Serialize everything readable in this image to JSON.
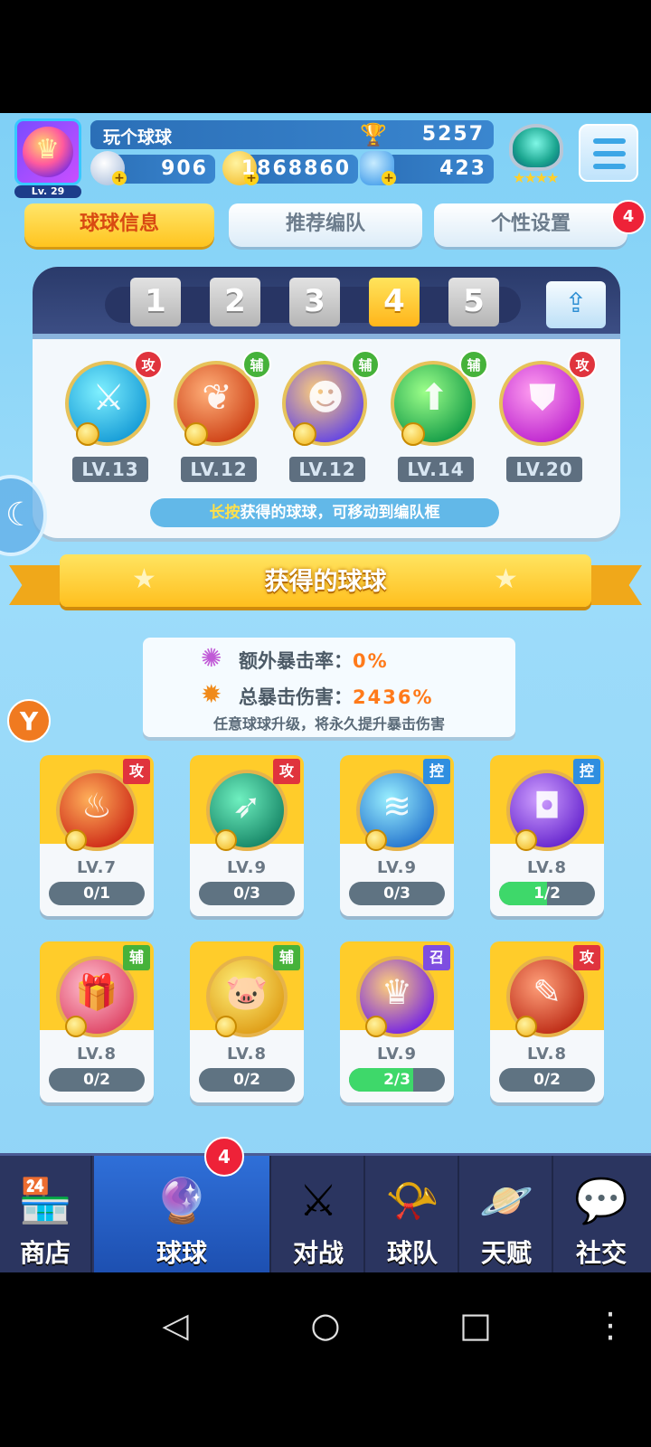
{
  "player": {
    "name": "玩个球球",
    "level_label": "Lv. 29",
    "trophies": "5257",
    "currency": [
      {
        "name": "silver",
        "value": "906",
        "color": "#c4d6ee"
      },
      {
        "name": "gold",
        "value": "1868860",
        "color": "#ffd21a"
      },
      {
        "name": "diamond",
        "value": "423",
        "color": "#4ab0ff"
      }
    ]
  },
  "tabs": [
    {
      "label": "球球信息",
      "active": true
    },
    {
      "label": "推荐编队",
      "active": false
    },
    {
      "label": "个性设置",
      "active": false,
      "badge": "4"
    }
  ],
  "team": {
    "slots": [
      "1",
      "2",
      "3",
      "4",
      "5"
    ],
    "selected_slot": "4",
    "balls": [
      {
        "tag": "攻",
        "tag_type": "atk",
        "level": "LV.13",
        "colors": [
          "#7ff0ff",
          "#1a9fd8"
        ],
        "icon": "blades-icon",
        "glyph": "⚔"
      },
      {
        "tag": "辅",
        "tag_type": "sup",
        "level": "LV.12",
        "colors": [
          "#ffb07a",
          "#d0461a"
        ],
        "icon": "wings-icon",
        "glyph": "❦"
      },
      {
        "tag": "辅",
        "tag_type": "sup",
        "level": "LV.12",
        "colors": [
          "#ffd07a",
          "#6a4ae0"
        ],
        "icon": "people-icon",
        "glyph": "☻"
      },
      {
        "tag": "辅",
        "tag_type": "sup",
        "level": "LV.14",
        "colors": [
          "#9dff8a",
          "#1aa04a"
        ],
        "icon": "arrow-up-icon",
        "glyph": "⬆"
      },
      {
        "tag": "攻",
        "tag_type": "atk",
        "level": "LV.20",
        "colors": [
          "#ff9ef0",
          "#c02ad0"
        ],
        "icon": "shield-icon",
        "glyph": "⛊"
      }
    ],
    "hint_highlight": "长按",
    "hint_text": "获得的球球，可移动到编队框"
  },
  "collection": {
    "title": "获得的球球",
    "extra_crit_label": "额外暴击率：",
    "extra_crit_value": "0%",
    "total_crit_label": "总暴击伤害：",
    "total_crit_value": "2436%",
    "note": "任意球球升级，将永久提升暴击伤害"
  },
  "cards": [
    {
      "tag": "攻",
      "tag_type": "atk",
      "level": "LV.7",
      "progress": "0/1",
      "fraction": 0.0,
      "colors": [
        "#ffb05a",
        "#d0301a"
      ],
      "icon": "dragon-icon",
      "glyph": "♨"
    },
    {
      "tag": "攻",
      "tag_type": "atk",
      "level": "LV.9",
      "progress": "0/3",
      "fraction": 0.0,
      "colors": [
        "#6ff0c0",
        "#1a8a6a"
      ],
      "icon": "bow-icon",
      "glyph": "➶"
    },
    {
      "tag": "控",
      "tag_type": "ctl",
      "level": "LV.9",
      "progress": "0/3",
      "fraction": 0.0,
      "colors": [
        "#9af0ff",
        "#2a7ad0"
      ],
      "icon": "wind-icon",
      "glyph": "≋"
    },
    {
      "tag": "控",
      "tag_type": "ctl",
      "level": "LV.8",
      "progress": "1/2",
      "fraction": 0.5,
      "colors": [
        "#d0a0ff",
        "#6a2ad0"
      ],
      "icon": "cage-icon",
      "glyph": "◘"
    },
    {
      "tag": "辅",
      "tag_type": "sup",
      "level": "LV.8",
      "progress": "0/2",
      "fraction": 0.0,
      "colors": [
        "#ffc0d0",
        "#e04a6a"
      ],
      "icon": "gift-icon",
      "glyph": "🎁"
    },
    {
      "tag": "辅",
      "tag_type": "sup",
      "level": "LV.8",
      "progress": "0/2",
      "fraction": 0.0,
      "colors": [
        "#fff07a",
        "#e0a01a"
      ],
      "icon": "piggy-bank-icon",
      "glyph": "🐷"
    },
    {
      "tag": "召",
      "tag_type": "sum",
      "level": "LV.9",
      "progress": "2/3",
      "fraction": 0.667,
      "colors": [
        "#ffd07a",
        "#7a2ae0"
      ],
      "icon": "phoenix-icon",
      "glyph": "♛"
    },
    {
      "tag": "攻",
      "tag_type": "atk",
      "level": "LV.8",
      "progress": "0/2",
      "fraction": 0.0,
      "colors": [
        "#ffa07a",
        "#c0301a"
      ],
      "icon": "scroll-icon",
      "glyph": "✎"
    }
  ],
  "nav": [
    {
      "label": "商店",
      "icon": "shop-icon",
      "glyph": "🏪",
      "active": false
    },
    {
      "label": "球球",
      "icon": "ball-icon",
      "glyph": "🔮",
      "active": true,
      "badge": "4"
    },
    {
      "label": "对战",
      "icon": "crossed-swords-icon",
      "glyph": "⚔",
      "active": false
    },
    {
      "label": "球队",
      "icon": "whistle-icon",
      "glyph": "📯",
      "active": false
    },
    {
      "label": "天赋",
      "icon": "planet-icon",
      "glyph": "🪐",
      "active": false
    },
    {
      "label": "社交",
      "icon": "chat-icon",
      "glyph": "💬",
      "active": false
    }
  ]
}
